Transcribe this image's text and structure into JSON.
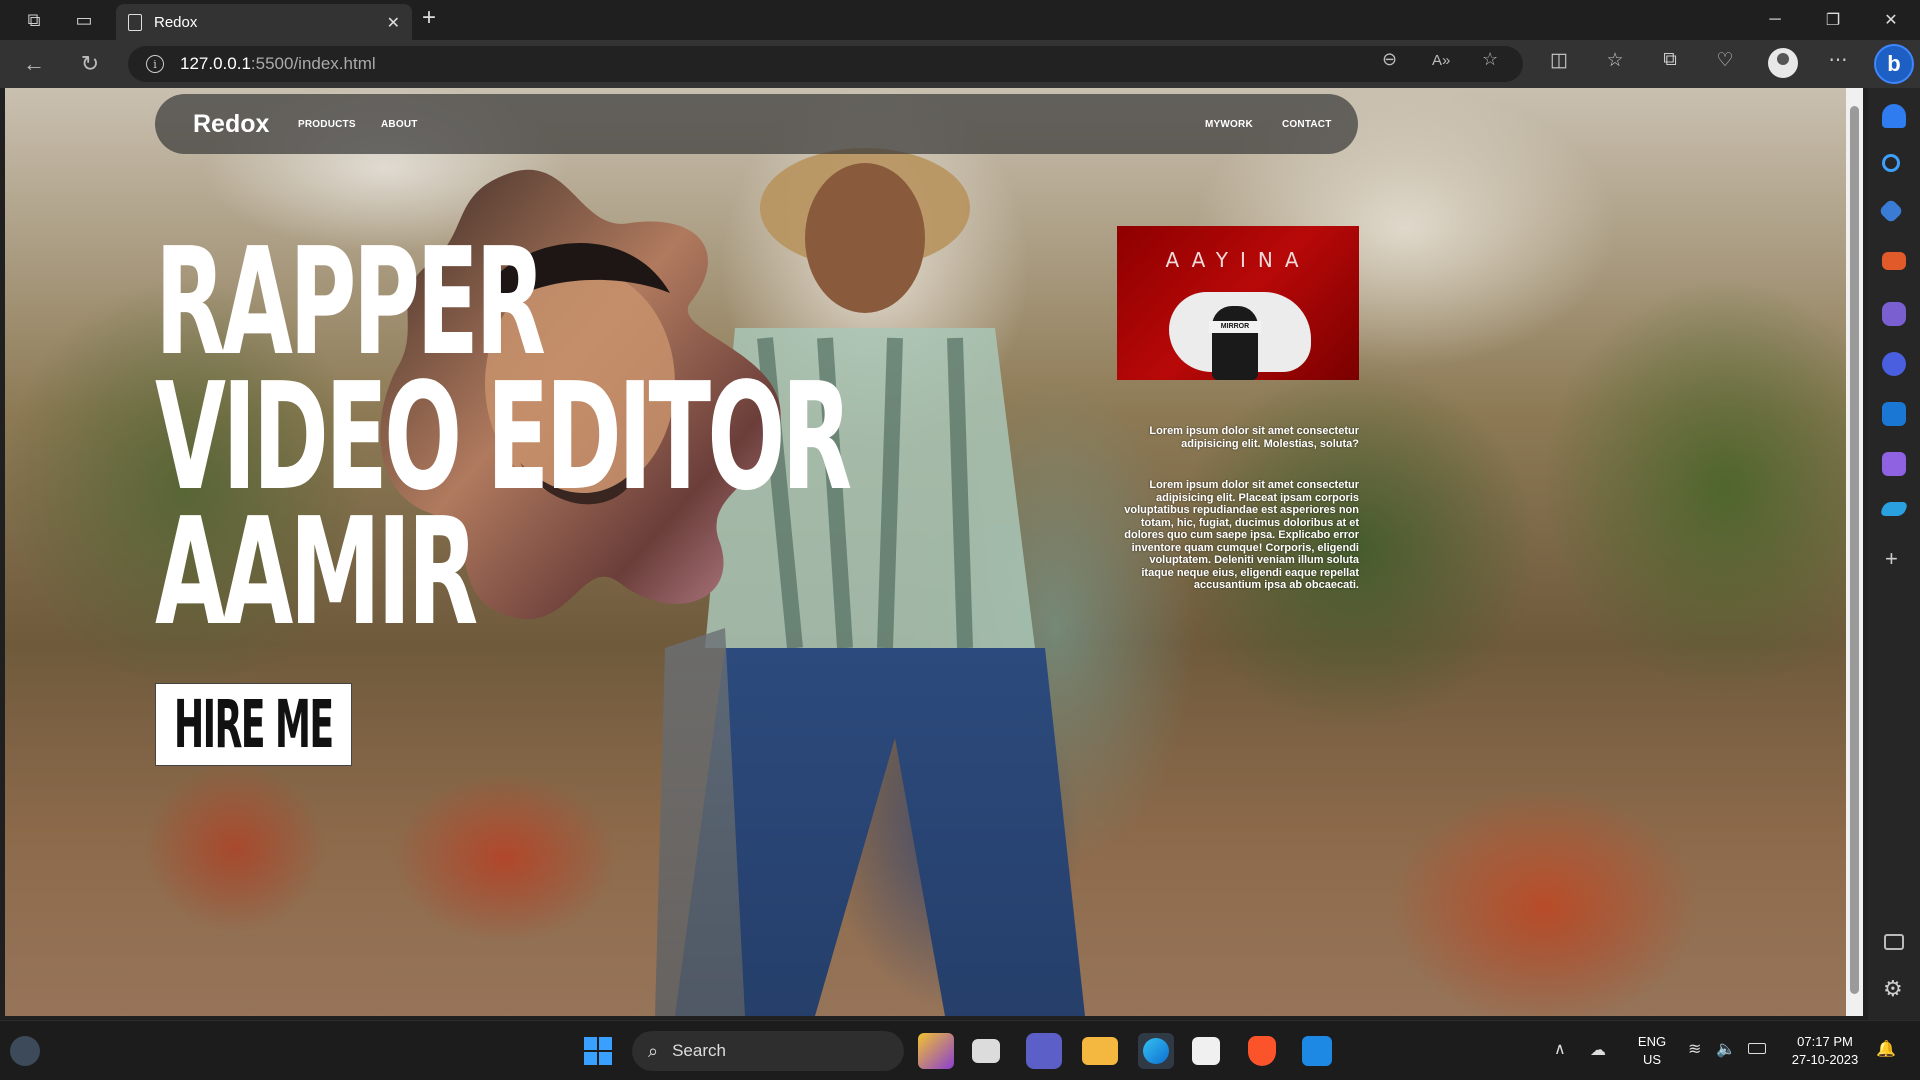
{
  "browser": {
    "tab_title": "Redox",
    "url_host": "127.0.0.1",
    "url_path": ":5500/index.html"
  },
  "site": {
    "logo": "Redox",
    "nav_left": [
      "PRODUCTS",
      "ABOUT"
    ],
    "nav_right": [
      "MYWORK",
      "CONTACT"
    ],
    "hero_lines": [
      "RAPPER",
      "VIDEO EDITOR",
      "AAMIR"
    ],
    "hire_button": "HIRE ME",
    "album_title": "AAYINA",
    "album_caption": "MIRROR",
    "para1": "Lorem ipsum dolor sit amet consectetur adipisicing elit. Molestias, soluta?",
    "para2": "Lorem ipsum dolor sit amet consectetur adipisicing elit. Placeat ipsam corporis voluptatibus repudiandae est asperiores non totam, hic, fugiat, ducimus doloribus at et dolores quo cum saepe ipsa. Explicabo error inventore quam cumque! Corporis, eligendi voluptatem. Deleniti veniam illum soluta itaque neque eius, eligendi eaque repellat accusantium ipsa ab obcaecati."
  },
  "taskbar": {
    "search_placeholder": "Search",
    "lang": "ENG",
    "region": "US",
    "time": "07:17 PM",
    "date": "27-10-2023"
  },
  "colors": {
    "album_red": "#b80808",
    "nav_bar": "#3c3c3c",
    "accent_blue": "#1e5fc4"
  }
}
